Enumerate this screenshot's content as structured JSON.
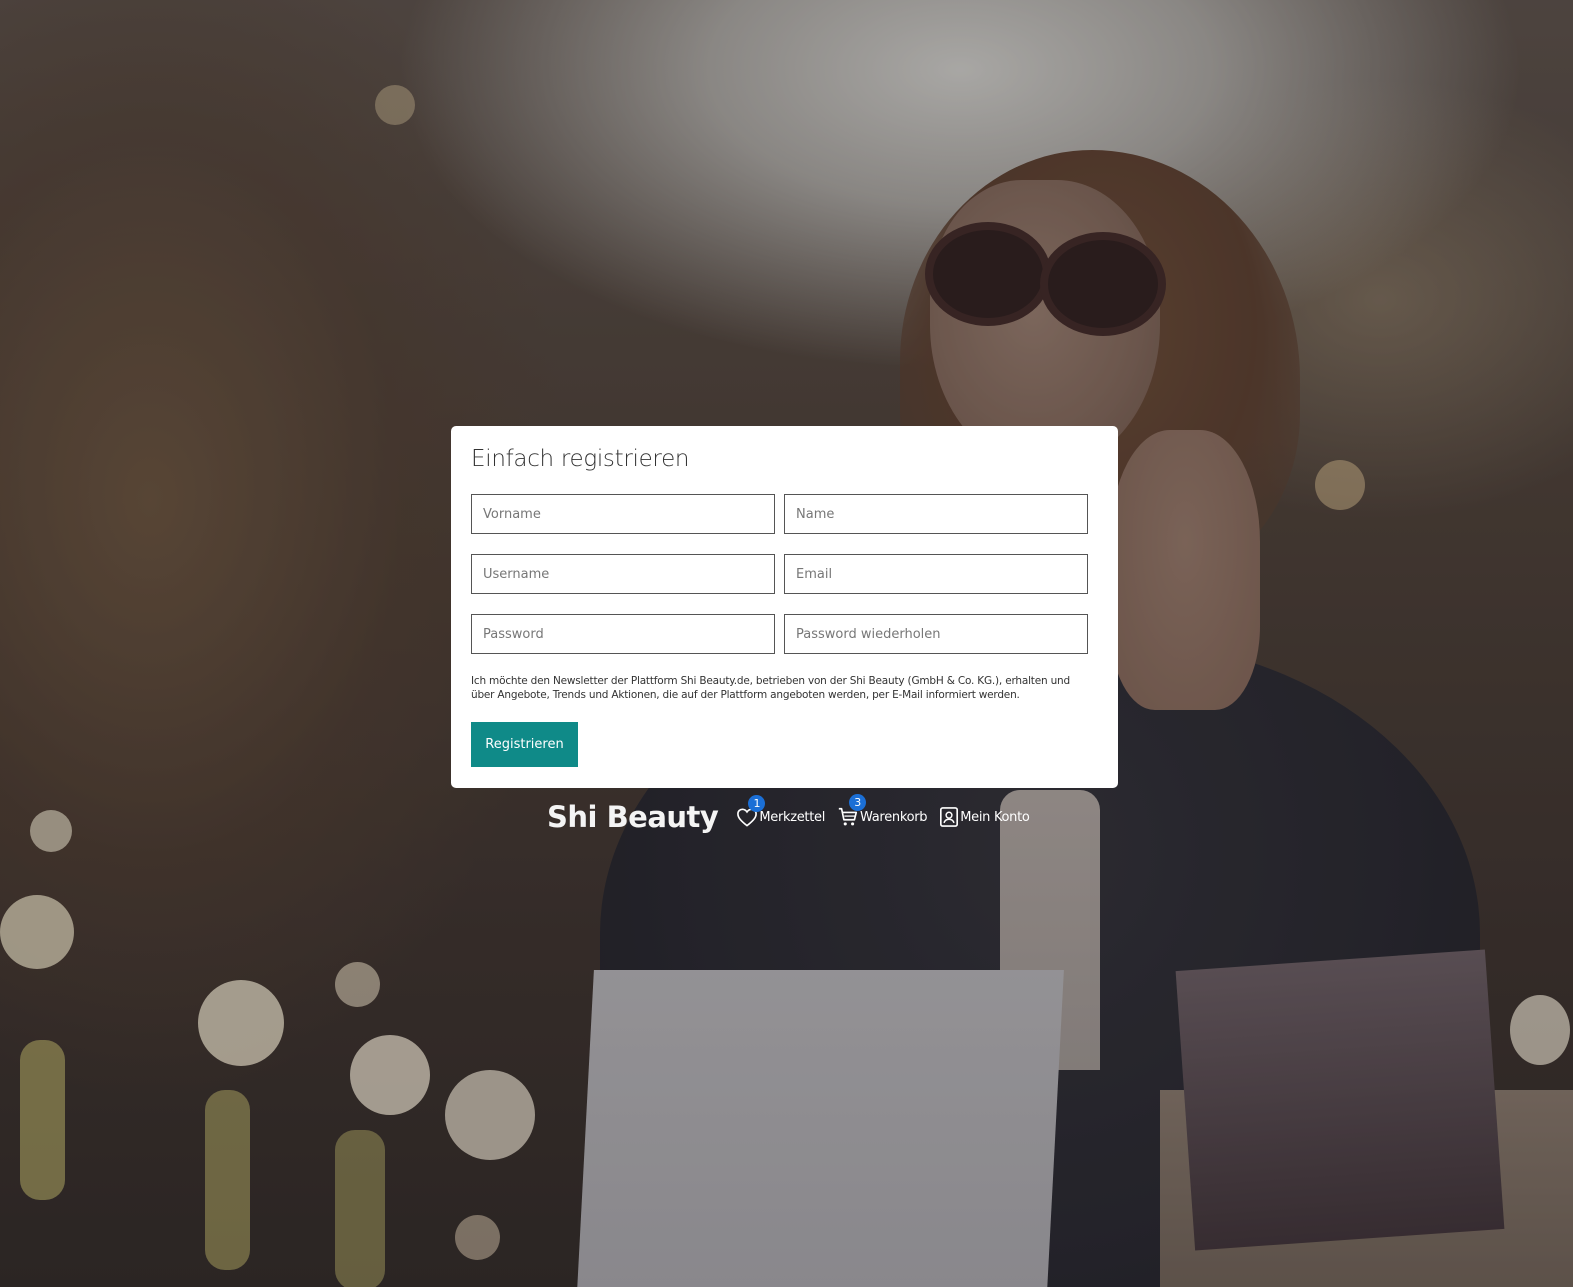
{
  "register_form": {
    "title": "Einfach registrieren",
    "fields": {
      "first_name_placeholder": "Vorname",
      "last_name_placeholder": "Name",
      "username_placeholder": "Username",
      "email_placeholder": "Email",
      "password_placeholder": "Password",
      "password_repeat_placeholder": "Password wiederholen"
    },
    "newsletter_consent": "Ich möchte den Newsletter der Plattform Shi Beauty.de, betrieben von der Shi Beauty (GmbH & Co. KG.), erhalten und über Angebote, Trends und Aktionen, die auf der Plattform angeboten werden, per E-Mail informiert werden.",
    "submit_label": "Registrieren",
    "accent_color": "#0f8a88"
  },
  "navbar": {
    "logo": "Shi Beauty",
    "wishlist": {
      "label": "Merkzettel",
      "count": "1",
      "icon": "heart-icon"
    },
    "cart": {
      "label": "Warenkorb",
      "count": "3",
      "icon": "cart-icon"
    },
    "account": {
      "label": "Mein Konto",
      "icon": "account-icon"
    },
    "badge_color": "#1b6fd6"
  }
}
